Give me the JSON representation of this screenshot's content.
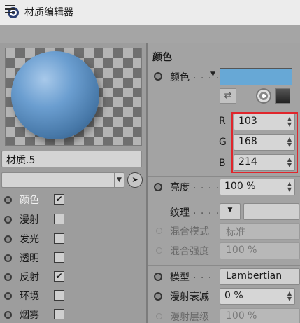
{
  "window": {
    "title": "材质编辑器"
  },
  "material": {
    "name": "材质.5"
  },
  "channels": [
    {
      "label": "颜色",
      "checked": true,
      "active": true
    },
    {
      "label": "漫射",
      "checked": false,
      "active": false
    },
    {
      "label": "发光",
      "checked": false,
      "active": false
    },
    {
      "label": "透明",
      "checked": false,
      "active": false
    },
    {
      "label": "反射",
      "checked": true,
      "active": false
    },
    {
      "label": "环境",
      "checked": false,
      "active": false
    },
    {
      "label": "烟雾",
      "checked": false,
      "active": false
    }
  ],
  "color_section": {
    "title": "颜色",
    "color_label": "颜色",
    "color_dots": ". . . .",
    "swatch_color": "#67a8d6",
    "r_label": "R",
    "r_value": "103",
    "g_label": "G",
    "g_value": "168",
    "b_label": "B",
    "b_value": "214",
    "brightness_label": "亮度",
    "brightness_dots": ". . . .",
    "brightness_value": "100 %",
    "texture_label": "纹理",
    "texture_dots": ". . . .",
    "blend_mode_label": "混合模式",
    "blend_mode_value": "标准",
    "blend_strength_label": "混合强度",
    "blend_strength_value": "100 %",
    "model_label": "模型",
    "model_dots": ". . .",
    "model_value": "Lambertian",
    "diffuse_falloff_label": "漫射衰减",
    "diffuse_falloff_value": "0 %",
    "diffuse_levels_label": "漫射层级",
    "diffuse_levels_value": "100 %"
  },
  "colors": {
    "highlight_box": "#e0262c",
    "sphere": "#5a8fc4"
  },
  "icons": [
    "app-icon",
    "menu-icon",
    "dropdown-chevron-icon",
    "picker-icon",
    "color-wheel-icon",
    "spectrum-icon",
    "swatch-tool-icon",
    "stepper-icon"
  ]
}
